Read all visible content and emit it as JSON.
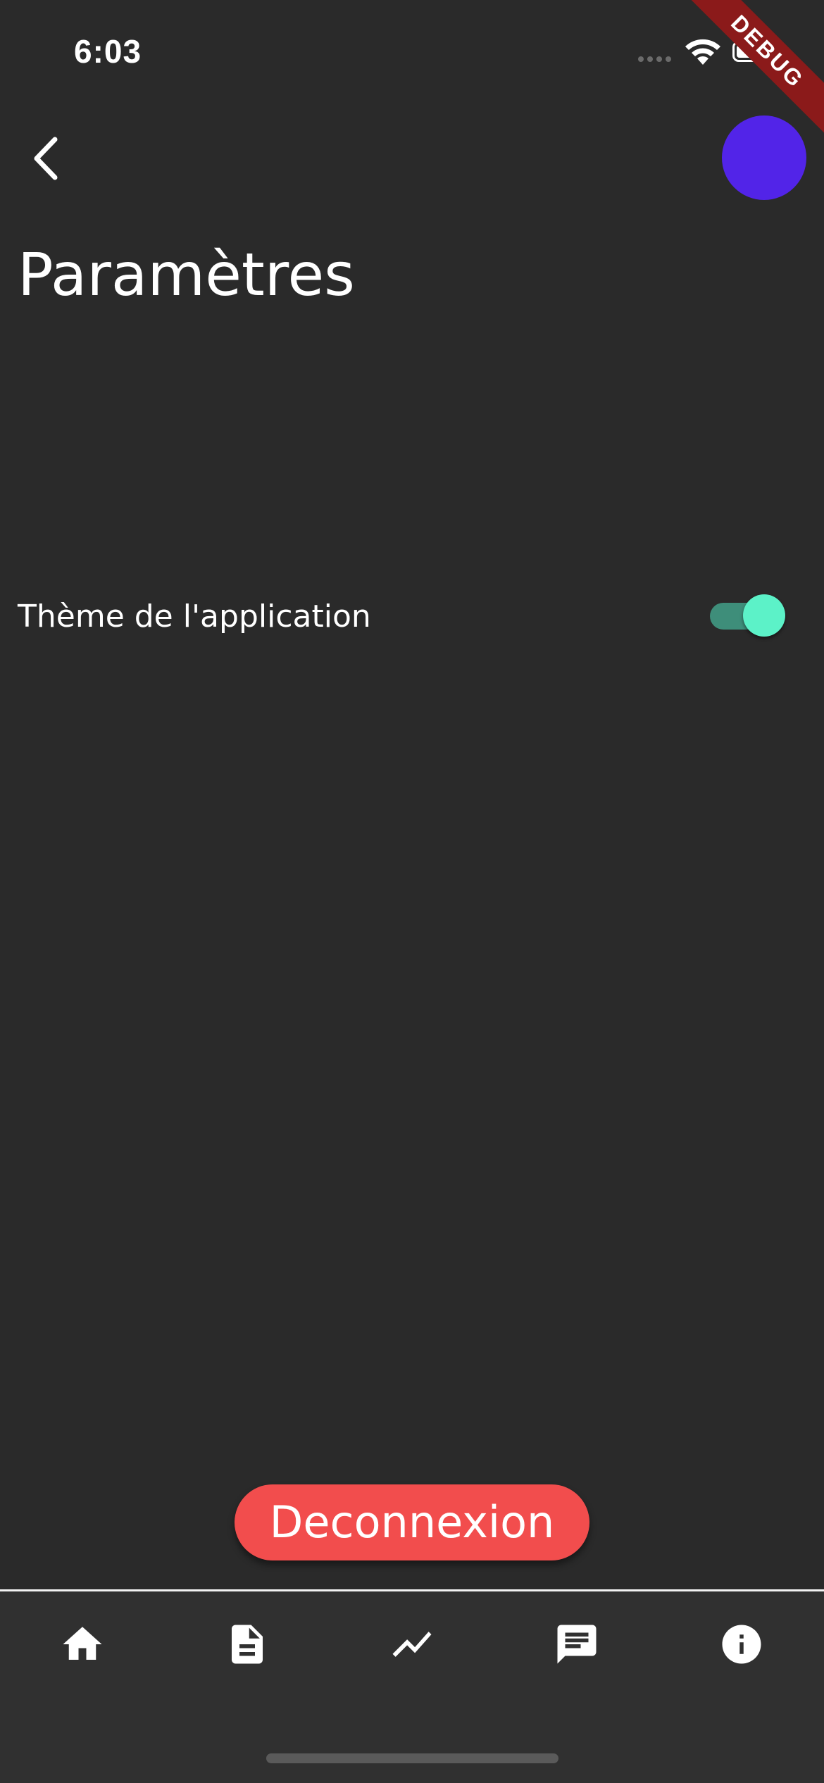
{
  "status_bar": {
    "time": "6:03"
  },
  "debug_banner": {
    "label": "DEBUG"
  },
  "header": {
    "back_icon": "chevron-left-icon",
    "avatar_color": "#5224e8",
    "title": "Paramètres"
  },
  "settings": {
    "theme": {
      "label": "Thème de l'application",
      "enabled": true,
      "track_color": "#3e8e7a",
      "thumb_color": "#5cf2c8"
    }
  },
  "logout": {
    "label": "Deconnexion",
    "color": "#f24d4d"
  },
  "bottom_nav": {
    "items": [
      {
        "id": "home",
        "icon": "home-icon"
      },
      {
        "id": "documents",
        "icon": "document-icon"
      },
      {
        "id": "stats",
        "icon": "trending-icon"
      },
      {
        "id": "messages",
        "icon": "chat-icon"
      },
      {
        "id": "info",
        "icon": "info-icon"
      }
    ]
  },
  "colors": {
    "background": "#2a2a2a",
    "nav_background": "#303030"
  }
}
